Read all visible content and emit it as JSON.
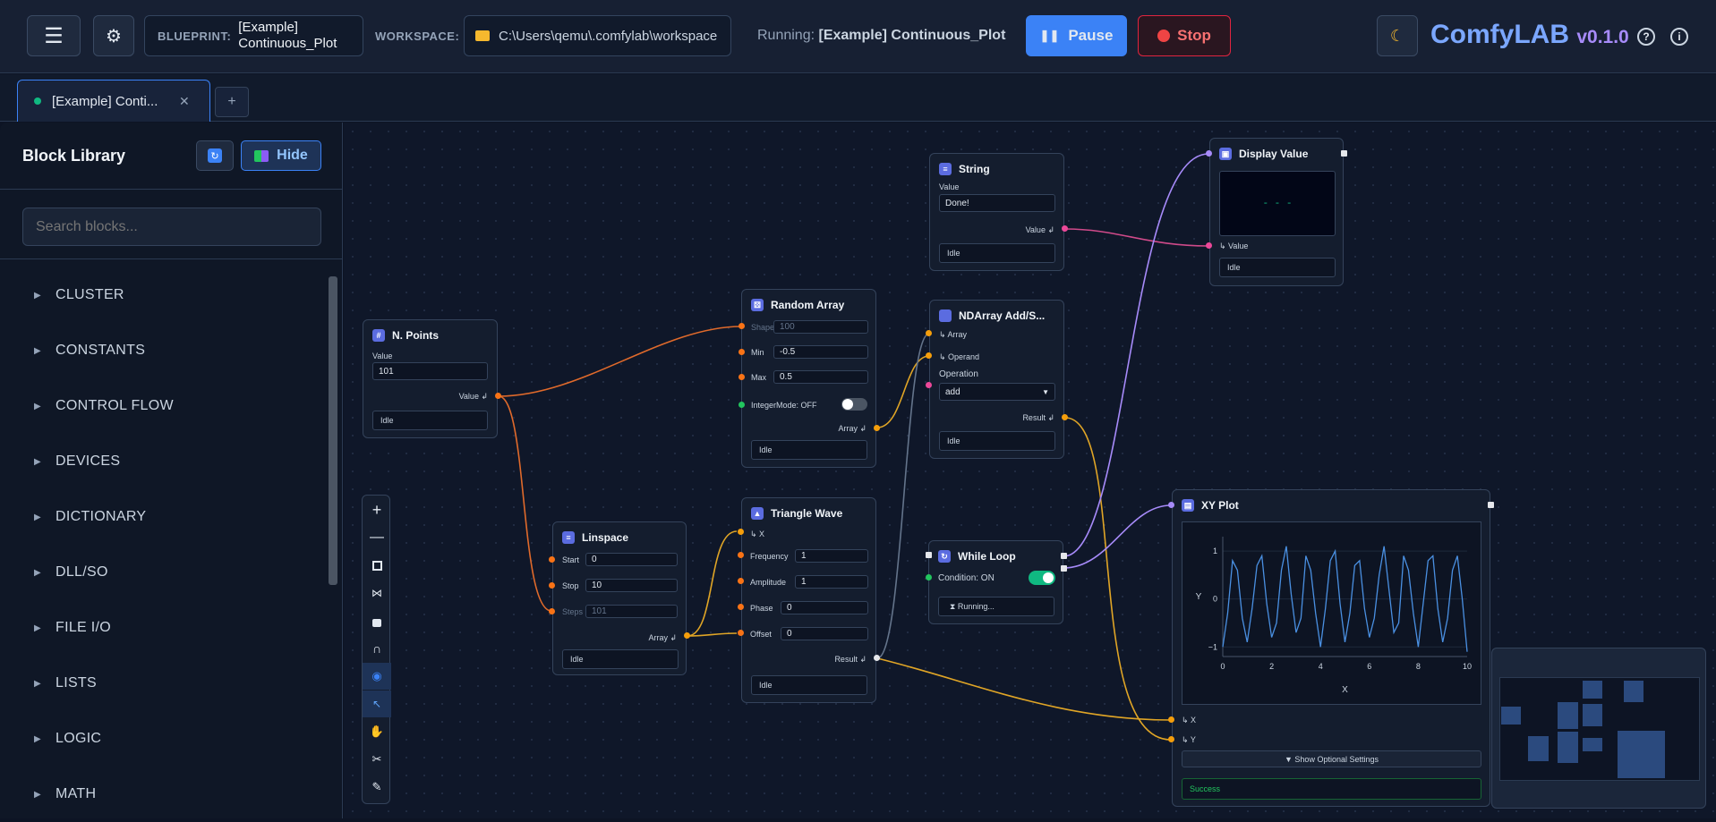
{
  "header": {
    "blueprint_label": "BLUEPRINT:",
    "blueprint_line1": "[Example]",
    "blueprint_line2": "Continuous_Plot",
    "workspace_label": "WORKSPACE:",
    "workspace_path": "C:\\Users\\qemu\\.comfylab\\workspace",
    "running_label": "Running:",
    "running_name": "[Example] Continuous_Plot",
    "pause_label": "Pause",
    "stop_label": "Stop",
    "brand": "ComfyLAB",
    "version": "v0.1.0",
    "icons": [
      "menu-icon",
      "gear-icon",
      "folder-icon",
      "pause-icon",
      "stop-icon",
      "moon-icon",
      "help-icon",
      "info-icon"
    ]
  },
  "tabs": [
    {
      "label": "[Example] Conti...",
      "close": "✕"
    }
  ],
  "add_tab": "+",
  "sidebar": {
    "title": "Block Library",
    "hide_label": "Hide",
    "search_placeholder": "Search blocks...",
    "categories": [
      "CLUSTER",
      "CONSTANTS",
      "CONTROL FLOW",
      "DEVICES",
      "DICTIONARY",
      "DLL/SO",
      "FILE I/O",
      "LISTS",
      "LOGIC",
      "MATH"
    ]
  },
  "nodes": {
    "npoints": {
      "title": "N. Points",
      "value_label": "Value",
      "value": "101",
      "out": "Value ↲",
      "status": "Idle"
    },
    "random": {
      "title": "Random Array",
      "shape_label": "Shape",
      "shape": "100",
      "min_label": "Min",
      "min": "-0.5",
      "max_label": "Max",
      "max": "0.5",
      "int_label": "IntegerMode: OFF",
      "out": "Array ↲",
      "status": "Idle"
    },
    "linspace": {
      "title": "Linspace",
      "start_label": "Start",
      "start": "0",
      "stop_label": "Stop",
      "stop": "10",
      "steps_label": "Steps",
      "steps": "101",
      "out": "Array ↲",
      "status": "Idle"
    },
    "triangle": {
      "title": "Triangle Wave",
      "x_label": "↳ X",
      "freq_label": "Frequency",
      "freq": "1",
      "amp_label": "Amplitude",
      "amp": "1",
      "phase_label": "Phase",
      "phase": "0",
      "offset_label": "Offset",
      "offset": "0",
      "out": "Result ↲",
      "status": "Idle"
    },
    "string": {
      "title": "String",
      "value_label": "Value",
      "value": "Done!",
      "out": "Value ↲",
      "status": "Idle"
    },
    "ndarray": {
      "title": "NDArray Add/S...",
      "array_label": "↳ Array",
      "operand_label": "↳ Operand",
      "op_label": "Operation",
      "op": "add",
      "out": "Result ↲",
      "status": "Idle"
    },
    "whileloop": {
      "title": "While Loop",
      "cond_label": "Condition: ON",
      "status": "⧗ Running..."
    },
    "display": {
      "title": "Display Value",
      "screen": "- - -",
      "value_label": "↳ Value",
      "status": "Idle"
    },
    "xyplot": {
      "title": "XY Plot",
      "x_label": "↳ X",
      "y_label": "↳ Y",
      "optional": "▼ Show Optional Settings",
      "status": "Success"
    }
  },
  "chart_data": {
    "type": "line",
    "title": "",
    "xlabel": "X",
    "ylabel": "Y",
    "xlim": [
      0,
      10
    ],
    "ylim": [
      -1.2,
      1.3
    ],
    "x_ticks": [
      "0",
      "2",
      "4",
      "6",
      "8",
      "10"
    ],
    "y_ticks": [
      "1",
      "0",
      "−1"
    ],
    "color": "#4a90e2",
    "x": [
      0,
      0.2,
      0.4,
      0.6,
      0.8,
      1,
      1.2,
      1.4,
      1.6,
      1.8,
      2,
      2.2,
      2.4,
      2.6,
      2.8,
      3,
      3.2,
      3.4,
      3.6,
      3.8,
      4,
      4.2,
      4.4,
      4.6,
      4.8,
      5,
      5.2,
      5.4,
      5.6,
      5.8,
      6,
      6.2,
      6.4,
      6.6,
      6.8,
      7,
      7.2,
      7.4,
      7.6,
      7.8,
      8,
      8.2,
      8.4,
      8.6,
      8.8,
      9,
      9.2,
      9.4,
      9.6,
      9.8,
      10
    ],
    "y": [
      -1.0,
      -0.3,
      0.8,
      0.6,
      -0.4,
      -0.9,
      -0.2,
      0.7,
      0.9,
      -0.1,
      -0.8,
      -0.5,
      0.6,
      1.1,
      0.1,
      -0.7,
      -0.4,
      0.9,
      0.6,
      -0.3,
      -1.0,
      -0.2,
      0.8,
      1.0,
      -0.1,
      -0.9,
      -0.3,
      0.7,
      0.8,
      -0.2,
      -0.8,
      -0.4,
      0.5,
      1.1,
      0.2,
      -0.7,
      -0.5,
      0.9,
      0.6,
      -0.3,
      -1.0,
      -0.1,
      0.8,
      0.9,
      -0.2,
      -0.9,
      -0.4,
      0.6,
      0.9,
      0.0,
      -1.1
    ]
  }
}
